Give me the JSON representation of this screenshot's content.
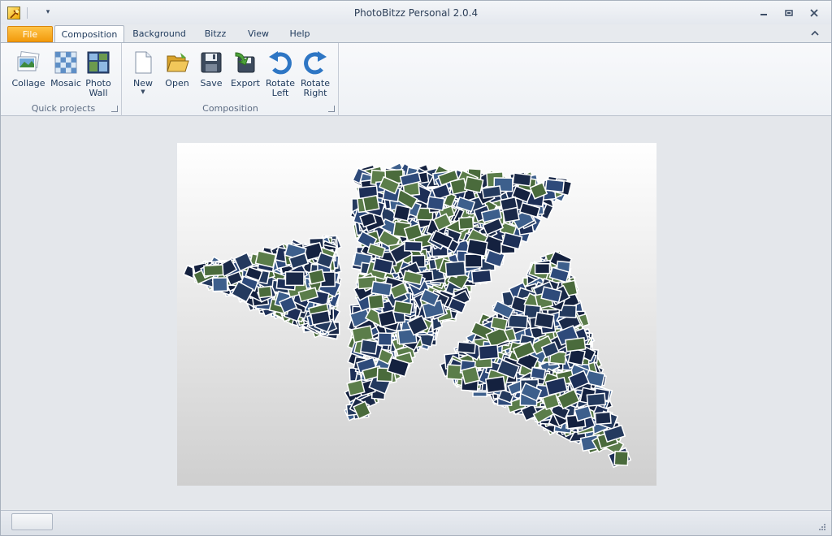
{
  "window": {
    "title": "PhotoBitzz Personal 2.0.4"
  },
  "tabs": [
    {
      "label": "File"
    },
    {
      "label": "Composition"
    },
    {
      "label": "Background"
    },
    {
      "label": "Bitzz"
    },
    {
      "label": "View"
    },
    {
      "label": "Help"
    }
  ],
  "groups": {
    "quick_projects": {
      "label": "Quick projects",
      "buttons": [
        {
          "label": "Collage",
          "icon": "collage-icon"
        },
        {
          "label": "Mosaic",
          "icon": "mosaic-icon"
        },
        {
          "label_line1": "Photo",
          "label_line2": "Wall",
          "icon": "photo-wall-icon"
        }
      ]
    },
    "composition": {
      "label": "Composition",
      "buttons": [
        {
          "label": "New",
          "icon": "new-document-icon"
        },
        {
          "label": "Open",
          "icon": "open-folder-icon"
        },
        {
          "label": "Save",
          "icon": "save-disk-icon"
        },
        {
          "label": "Export",
          "icon": "export-icon"
        },
        {
          "label_line1": "Rotate",
          "label_line2": "Left",
          "icon": "rotate-left-icon"
        },
        {
          "label_line1": "Rotate",
          "label_line2": "Right",
          "icon": "rotate-right-icon"
        }
      ]
    }
  },
  "colors": {
    "file_tab": "#f29a0c",
    "accent_blue": "#1e395b",
    "photo_dark": "#14213f",
    "photo_mid": "#2e4a7a"
  }
}
